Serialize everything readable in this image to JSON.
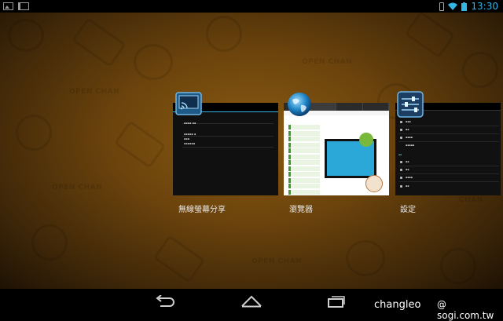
{
  "status_bar": {
    "time": "13:30",
    "left_icons": [
      "image-notification-icon",
      "screen-notification-icon"
    ],
    "right_icons": [
      "vibrate-icon",
      "wifi-icon",
      "battery-icon"
    ]
  },
  "wallpaper": {
    "watermark_text": "OPEN CHAN"
  },
  "recent_apps": [
    {
      "label": "無線螢幕分享",
      "icon": "wireless-display-icon"
    },
    {
      "label": "瀏覽器",
      "icon": "globe-icon"
    },
    {
      "label": "設定",
      "icon": "settings-sliders-icon"
    }
  ],
  "nav_bar": {
    "buttons": [
      "back-icon",
      "home-icon",
      "recents-icon"
    ]
  },
  "overlay": {
    "author": "changleo",
    "site": "@ sogi.com.tw"
  },
  "colors": {
    "accent": "#33b5e5",
    "wallpaper": "#7a4f10"
  }
}
